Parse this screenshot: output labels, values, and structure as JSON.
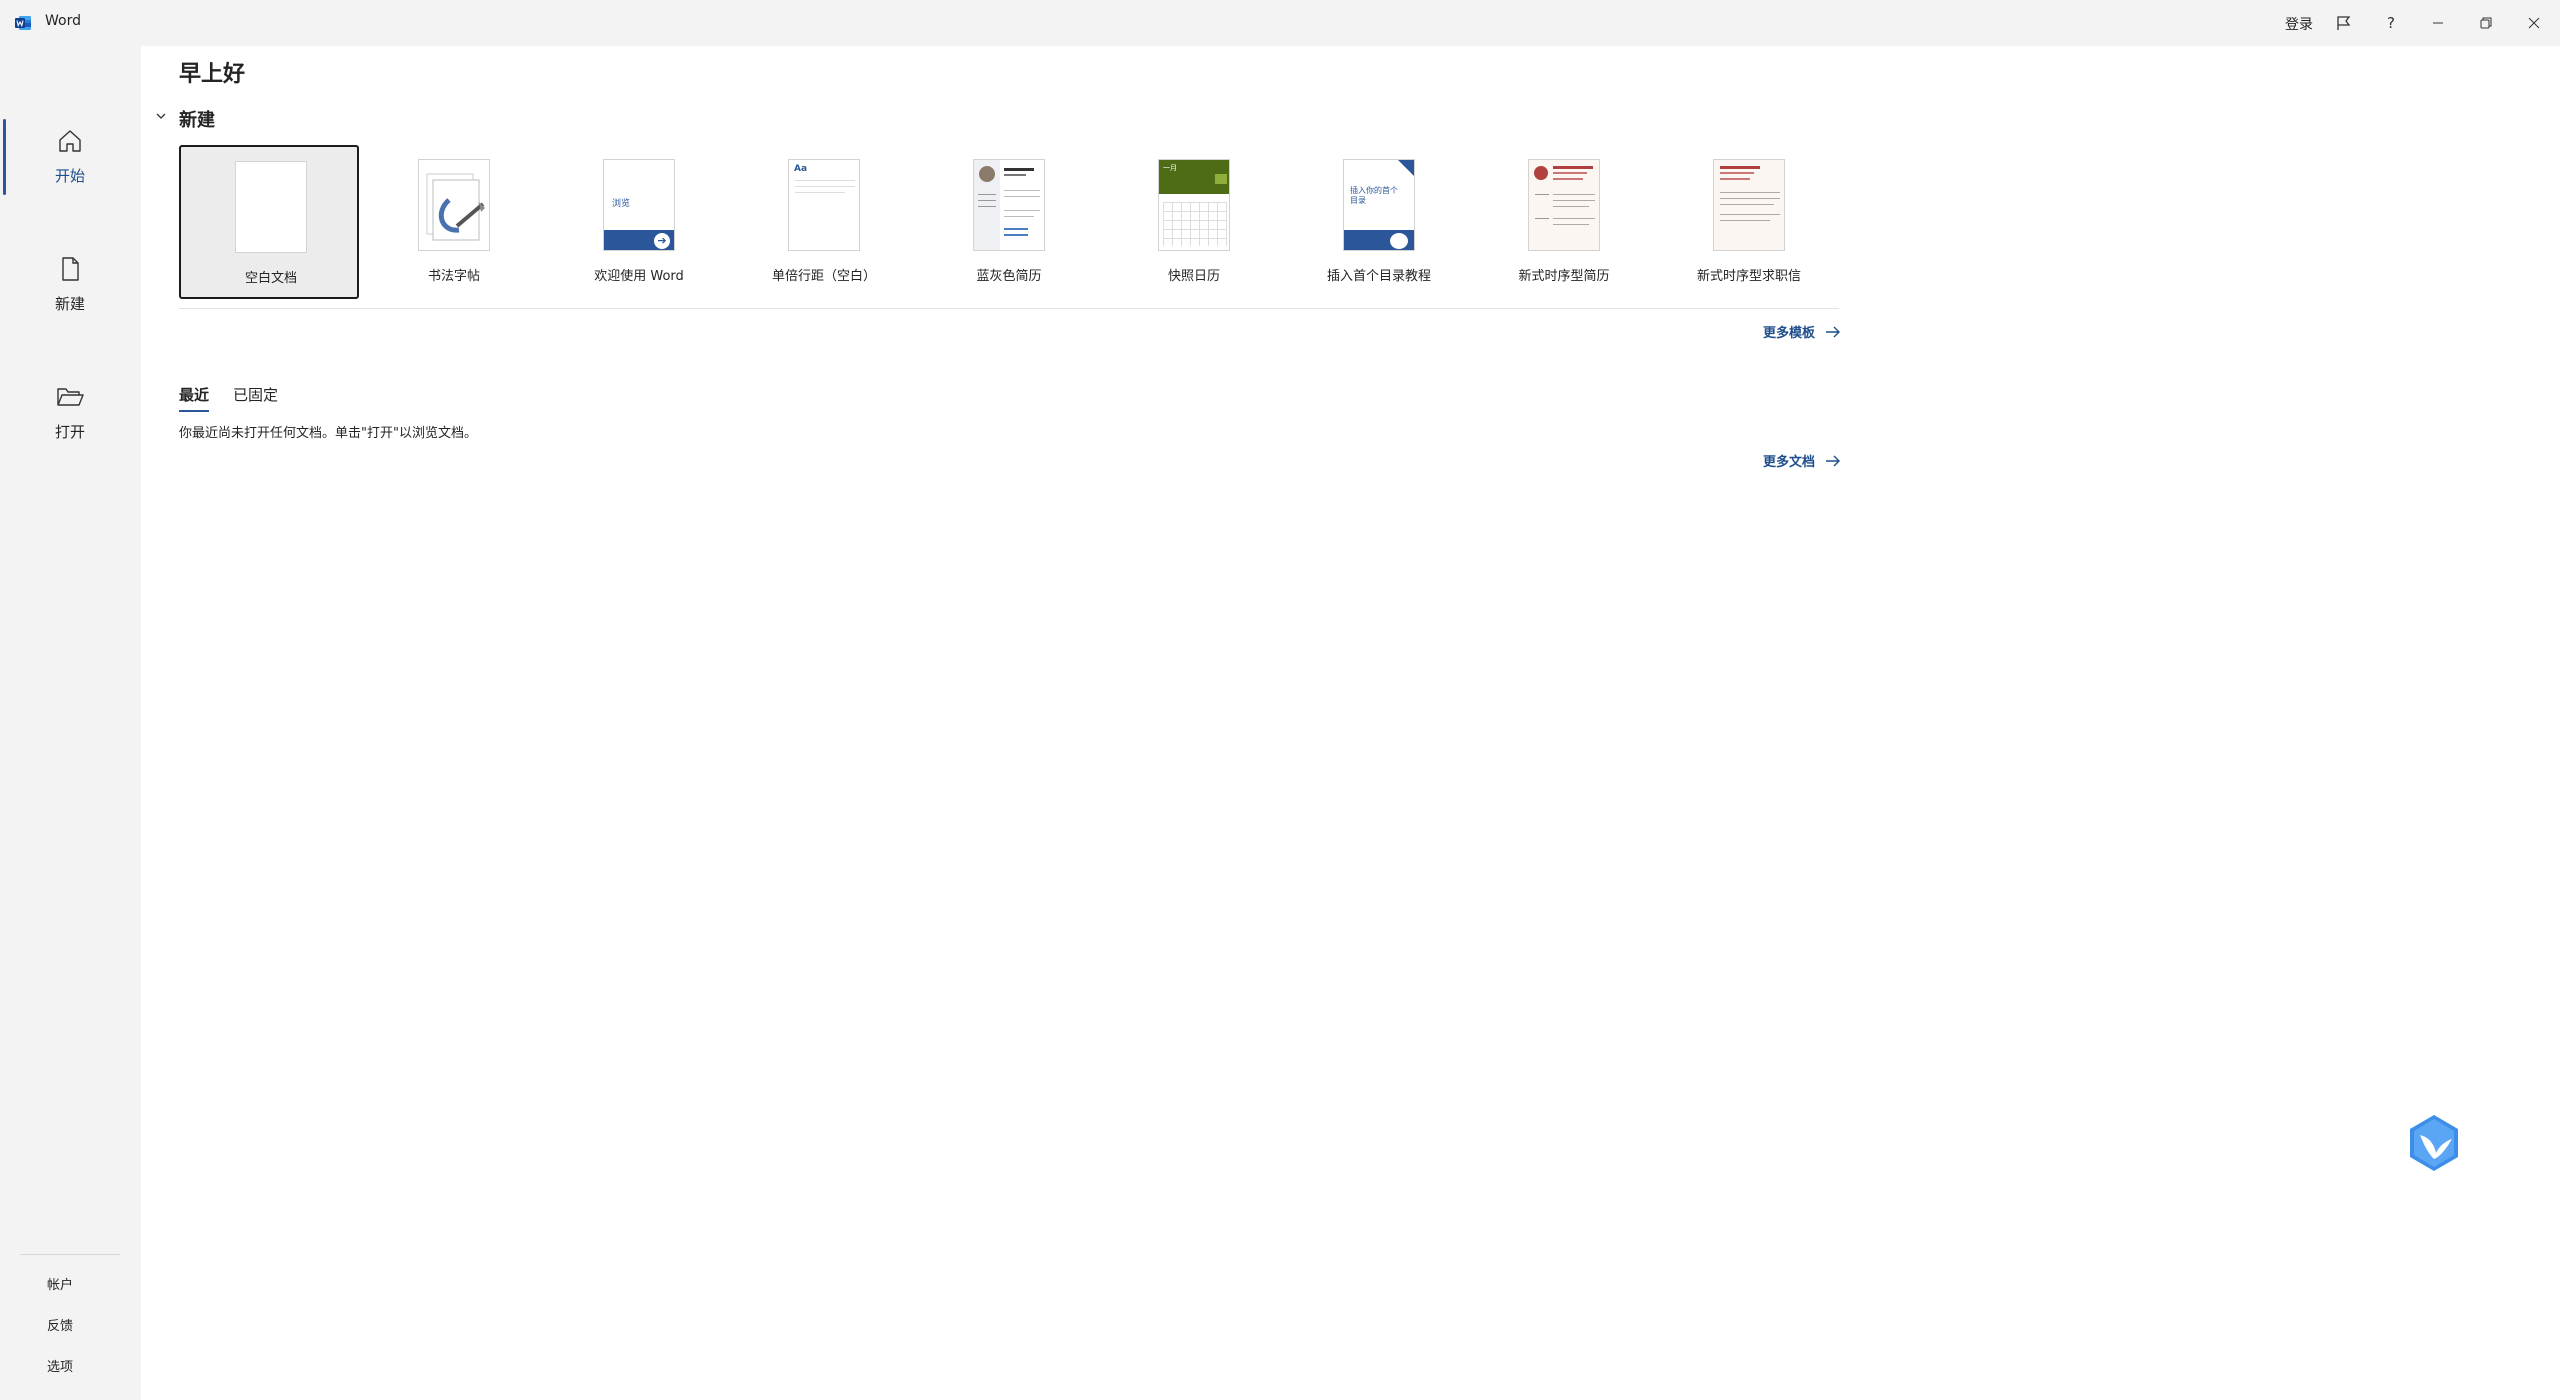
{
  "titlebar": {
    "app_title": "Word",
    "signin_label": "登录",
    "help_glyph": "?",
    "icons": {
      "app": "word-logo-icon",
      "feedback": "feedback-icon",
      "help": "help-icon",
      "minimize": "minimize-icon",
      "restore": "restore-icon",
      "close": "close-icon"
    }
  },
  "sidebar": {
    "items": [
      {
        "label": "开始",
        "icon": "home-icon",
        "active": true
      },
      {
        "label": "新建",
        "icon": "new-document-icon",
        "active": false
      },
      {
        "label": "打开",
        "icon": "folder-open-icon",
        "active": false
      }
    ],
    "bottom_links": [
      {
        "label": "帐户"
      },
      {
        "label": "反馈"
      },
      {
        "label": "选项"
      }
    ]
  },
  "main": {
    "greeting": "早上好",
    "new_section_title": "新建",
    "templates": [
      {
        "name": "空白文档",
        "selected": true
      },
      {
        "name": "书法字帖"
      },
      {
        "name": "欢迎使用 Word",
        "thumb_text": "浏览"
      },
      {
        "name": "单倍行距（空白）",
        "thumb_text": "Aa"
      },
      {
        "name": "蓝灰色简历"
      },
      {
        "name": "快照日历",
        "thumb_text": "一月"
      },
      {
        "name": "插入首个目录教程",
        "thumb_text": "插入你的首个目录"
      },
      {
        "name": "新式时序型简历"
      },
      {
        "name": "新式时序型求职信"
      }
    ],
    "more_templates": "更多模板",
    "tabs": [
      {
        "label": "最近",
        "active": true
      },
      {
        "label": "已固定",
        "active": false
      }
    ],
    "empty_message": "你最近尚未打开任何文档。单击\"打开\"以浏览文档。",
    "more_documents": "更多文档"
  },
  "colors": {
    "accent": "#2b579a",
    "link": "#1f4e8c",
    "sidebar_bg": "#f3f3f3",
    "main_bg": "#ffffff",
    "calendar_green": "#4e6b16",
    "resume_accent": "#b0413e"
  },
  "assistant_icon": "assistant-bird-icon"
}
